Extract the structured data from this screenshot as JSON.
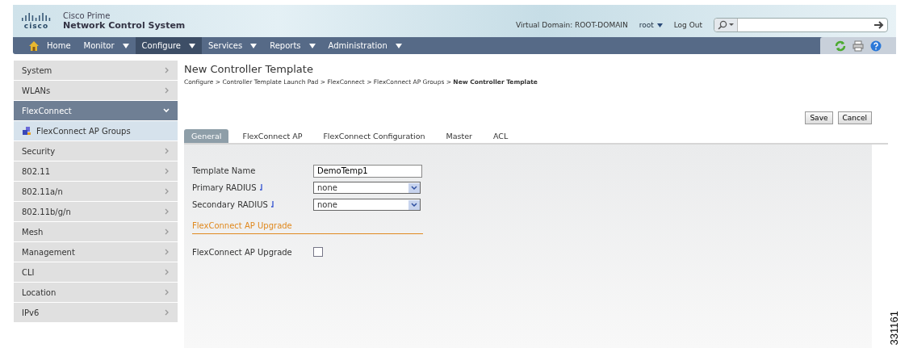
{
  "header": {
    "brand": "cisco",
    "product_line": "Cisco Prime",
    "product": "Network Control System",
    "virtual_domain": "Virtual Domain: ROOT-DOMAIN",
    "user": "root",
    "logout": "Log Out"
  },
  "nav": [
    {
      "label": "Home",
      "dropdown": false,
      "selected": false
    },
    {
      "label": "Monitor",
      "dropdown": true,
      "selected": false
    },
    {
      "label": "Configure",
      "dropdown": true,
      "selected": true
    },
    {
      "label": "Services",
      "dropdown": true,
      "selected": false
    },
    {
      "label": "Reports",
      "dropdown": true,
      "selected": false
    },
    {
      "label": "Administration",
      "dropdown": true,
      "selected": false
    }
  ],
  "sidebar": {
    "items": [
      {
        "label": "System",
        "selected": false,
        "expanded": false
      },
      {
        "label": "WLANs",
        "selected": false,
        "expanded": false
      },
      {
        "label": "FlexConnect",
        "selected": true,
        "expanded": true,
        "children": [
          {
            "label": "FlexConnect AP Groups",
            "selected": true
          }
        ]
      },
      {
        "label": "Security",
        "selected": false,
        "expanded": false
      },
      {
        "label": "802.11",
        "selected": false,
        "expanded": false
      },
      {
        "label": "802.11a/n",
        "selected": false,
        "expanded": false
      },
      {
        "label": "802.11b/g/n",
        "selected": false,
        "expanded": false
      },
      {
        "label": "Mesh",
        "selected": false,
        "expanded": false
      },
      {
        "label": "Management",
        "selected": false,
        "expanded": false
      },
      {
        "label": "CLI",
        "selected": false,
        "expanded": false
      },
      {
        "label": "Location",
        "selected": false,
        "expanded": false
      },
      {
        "label": "IPv6",
        "selected": false,
        "expanded": false
      }
    ]
  },
  "page": {
    "title": "New Controller Template",
    "breadcrumb": "Configure > Controller Template Launch Pad > FlexConnect > FlexConnect AP Groups > **New Controller Template**",
    "buttons": [
      "Save",
      "Cancel"
    ]
  },
  "tabs": [
    {
      "label": "General",
      "selected": true
    },
    {
      "label": "FlexConnect AP",
      "selected": false
    },
    {
      "label": "FlexConnect Configuration",
      "selected": false
    },
    {
      "label": "Master",
      "selected": false
    },
    {
      "label": "ACL",
      "selected": false
    }
  ],
  "form": {
    "fields": [
      {
        "kind": "text",
        "label": "Template Name",
        "value": "DemoTemp1",
        "info": false
      },
      {
        "kind": "select",
        "label": "Primary RADIUS",
        "value": "none",
        "info": true
      },
      {
        "kind": "select",
        "label": "Secondary RADIUS",
        "value": "none",
        "info": true
      }
    ],
    "section": {
      "title": "FlexConnect AP Upgrade",
      "fields": [
        {
          "kind": "checkbox",
          "label": "FlexConnect AP Upgrade",
          "checked": false
        }
      ]
    }
  },
  "figure_number": "331161"
}
